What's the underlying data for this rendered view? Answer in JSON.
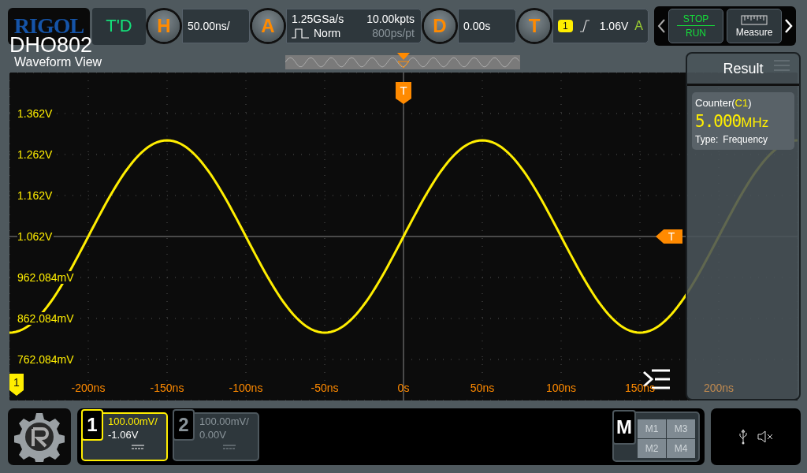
{
  "brand": {
    "logo": "RIGOL",
    "model": "DHO802"
  },
  "run_status": "T'D",
  "horizontal": {
    "key": "H",
    "scale": "50.00ns/"
  },
  "acquire": {
    "key": "A",
    "sample_rate": "1.25GSa/s",
    "mode": "Norm",
    "memory": "10.00kpts",
    "resolution": "800ps/pt"
  },
  "delay": {
    "key": "D",
    "value": "0.00s"
  },
  "trigger": {
    "key": "T",
    "source": "1",
    "level": "1.06V",
    "sweep": "A"
  },
  "controls": [
    {
      "kind": "run_stop",
      "top": "STOP",
      "bottom": "RUN"
    },
    {
      "kind": "measure",
      "label": "Measure"
    }
  ],
  "view": {
    "title": "Waveform View",
    "position_marker": "T",
    "level_marker": "T",
    "channel_marker": "1",
    "y_labels": [
      "1.362V",
      "1.262V",
      "1.162V",
      "1.062V",
      "962.084mV",
      "862.084mV",
      "762.084mV"
    ],
    "x_labels": [
      "-200ns",
      "-150ns",
      "-100ns",
      "-50ns",
      "0s",
      "50ns",
      "100ns",
      "150ns",
      "200ns"
    ]
  },
  "result": {
    "title": "Result",
    "label_prefix": "Counter(",
    "source": "C1",
    "label_suffix": ")",
    "value": "5.000",
    "unit": "MHz",
    "type_label": "Type:",
    "type_value": "Frequency"
  },
  "channels": [
    {
      "number": "1",
      "scale": "100.00mV/",
      "offset": "-1.06V",
      "on": true
    },
    {
      "number": "2",
      "scale": "100.00mV/",
      "offset": "0.00V",
      "on": false
    }
  ],
  "math": {
    "key": "M",
    "items": [
      "M1",
      "M3",
      "M2",
      "M4"
    ]
  }
}
